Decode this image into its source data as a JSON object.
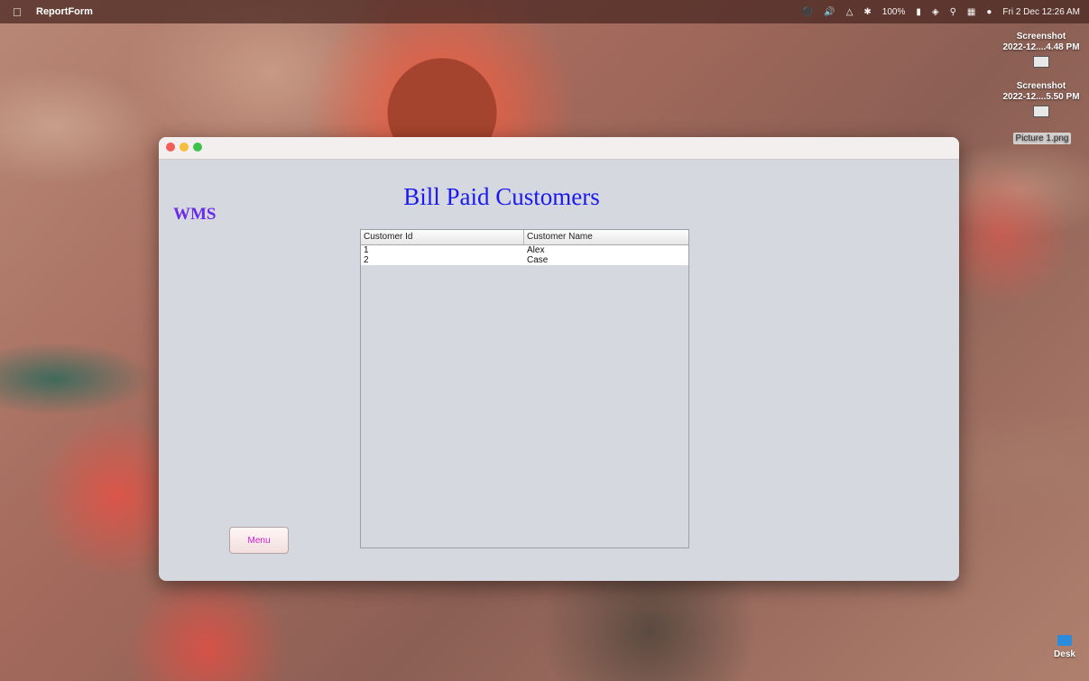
{
  "menubar": {
    "app_name": "ReportForm",
    "battery": "100%",
    "clock": "Fri 2 Dec  12:26 AM"
  },
  "desktop": {
    "items": [
      {
        "line1": "Screenshot",
        "line2": "2022-12....4.48 PM"
      },
      {
        "line1": "Screenshot",
        "line2": "2022-12....5.50 PM"
      }
    ],
    "picture_label": "Picture 1.png",
    "desk_label": "Desk"
  },
  "window": {
    "title": "Bill Paid Customers",
    "side_label": "WMS",
    "table": {
      "columns": [
        "Customer Id",
        "Customer Name"
      ],
      "rows": [
        [
          "1",
          "Alex"
        ],
        [
          "2",
          "Case"
        ]
      ]
    },
    "menu_button": "Menu"
  },
  "colors": {
    "heading": "#1a1aee",
    "side_label": "#6a2be8",
    "menu_text": "#d21ad2",
    "window_bg": "#d5d8df"
  }
}
